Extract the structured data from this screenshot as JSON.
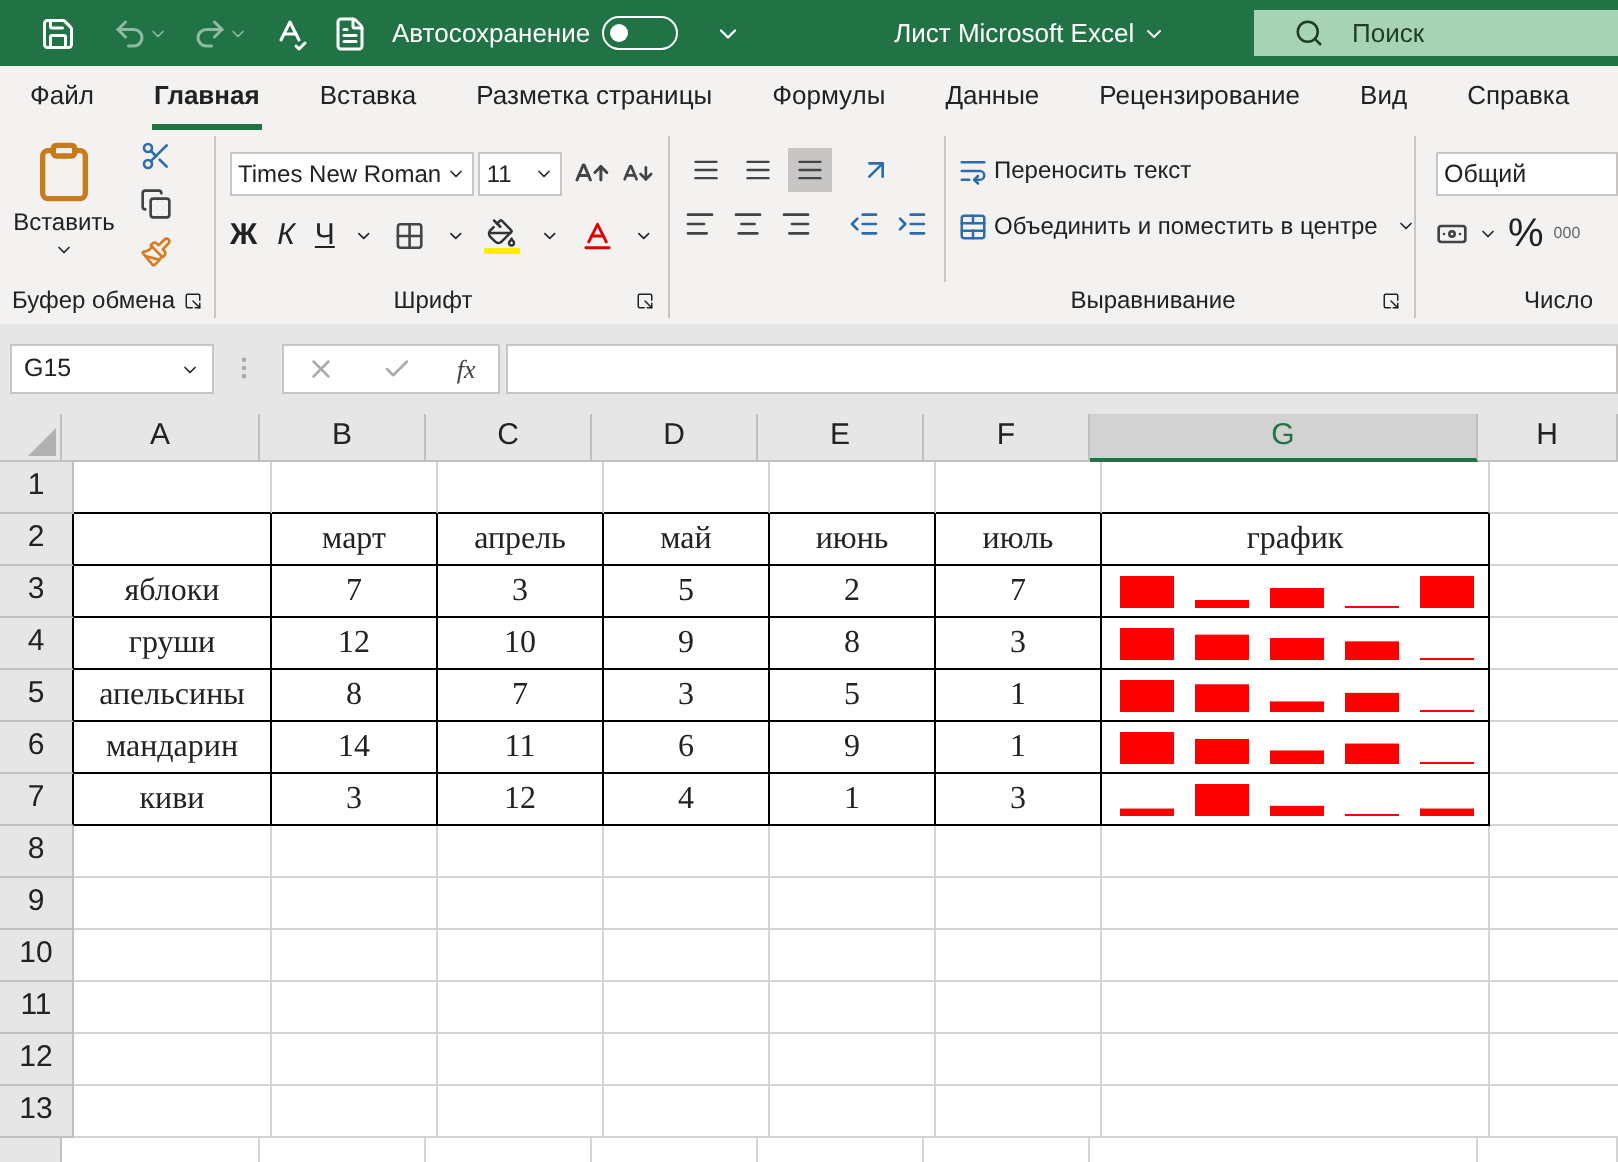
{
  "title_bar": {
    "autosave_label": "Автосохранение",
    "autosave_on": false,
    "document_title": "Лист Microsoft Excel",
    "search_placeholder": "Поиск"
  },
  "menu_tabs": [
    {
      "label": "Файл",
      "selected": false
    },
    {
      "label": "Главная",
      "selected": true
    },
    {
      "label": "Вставка",
      "selected": false
    },
    {
      "label": "Разметка страницы",
      "selected": false
    },
    {
      "label": "Формулы",
      "selected": false
    },
    {
      "label": "Данные",
      "selected": false
    },
    {
      "label": "Рецензирование",
      "selected": false
    },
    {
      "label": "Вид",
      "selected": false
    },
    {
      "label": "Справка",
      "selected": false
    }
  ],
  "ribbon": {
    "clipboard": {
      "paste_label": "Вставить",
      "group_label": "Буфер обмена"
    },
    "font": {
      "font_name": "Times New Roman",
      "font_size": "11",
      "bold_label": "Ж",
      "italic_label": "К",
      "underline_label": "Ч",
      "group_label": "Шрифт"
    },
    "alignment": {
      "vertical": [
        {
          "selected": false
        },
        {
          "selected": false
        },
        {
          "selected": true
        }
      ],
      "wrap_text": "Переносить текст",
      "merge_center": "Объединить и поместить в центре",
      "group_label": "Выравнивание"
    },
    "number": {
      "format": "Общий",
      "percent": "%",
      "thousands": "000",
      "group_label": "Число"
    }
  },
  "formula_bar": {
    "name_box": "G15",
    "function_label": "fx"
  },
  "sheet": {
    "columns": [
      "A",
      "B",
      "C",
      "D",
      "E",
      "F",
      "G",
      "H"
    ],
    "row_numbers": [
      "1",
      "2",
      "3",
      "4",
      "5",
      "6",
      "7",
      "8",
      "9",
      "10",
      "11",
      "12",
      "13"
    ],
    "table": {
      "header": [
        "март",
        "апрель",
        "май",
        "июнь",
        "июль"
      ],
      "chart_header": "график",
      "rows": [
        {
          "label": "яблоки",
          "values": [
            "7",
            "3",
            "5",
            "2",
            "7"
          ]
        },
        {
          "label": "груши",
          "values": [
            "12",
            "10",
            "9",
            "8",
            "3"
          ]
        },
        {
          "label": "апельсины",
          "values": [
            "8",
            "7",
            "3",
            "5",
            "1"
          ]
        },
        {
          "label": "мандарин",
          "values": [
            "14",
            "11",
            "6",
            "9",
            "1"
          ]
        },
        {
          "label": "киви",
          "values": [
            "3",
            "12",
            "4",
            "1",
            "3"
          ]
        }
      ]
    }
  }
}
